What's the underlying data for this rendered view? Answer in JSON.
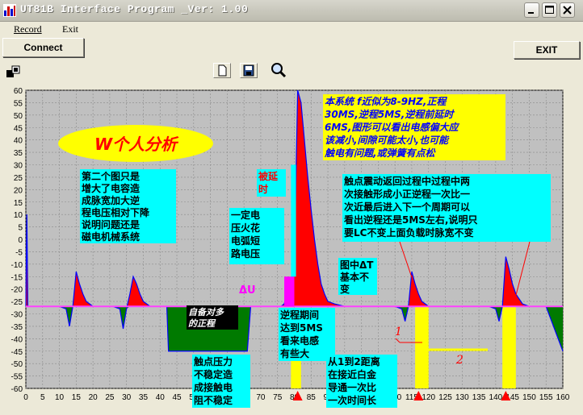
{
  "window": {
    "title": "UT81B Interface Program _Ver: 1.00"
  },
  "menu": {
    "record": "Record",
    "exit": "Exit"
  },
  "toolbar": {
    "connect": "Connect",
    "exit": "EXIT"
  },
  "icons": {
    "app": "bar-chart-icon",
    "minimize": "minimize-icon",
    "maximize": "maximize-icon",
    "close": "close-icon",
    "new": "new-file-icon",
    "save": "save-disk-icon",
    "zoom": "zoom-magnifier-icon",
    "panel": "panel-toggle-icon"
  },
  "colors": {
    "plot_bg": "#c0c0c0",
    "grid": "#8a8a8a",
    "pos_fill": "#ff0000",
    "neg_fill": "#007a00",
    "baseline": "#ff40ff",
    "trace": "#0000ff",
    "highlight": "#ffff00",
    "note_bg": "#ffff00",
    "note_text": "#0000ff",
    "cyan": "#00ffff",
    "magenta": "#ff00ff"
  },
  "chart_data": {
    "type": "area",
    "xlim": [
      0,
      160
    ],
    "ylim": [
      -60,
      60
    ],
    "x_ticks": [
      "0",
      "5",
      "10",
      "15",
      "20",
      "25",
      "30",
      "35",
      "40",
      "45",
      "50",
      "55",
      "60",
      "65",
      "70",
      "75",
      "80",
      "85",
      "90",
      "95",
      "100",
      "105",
      "110",
      "115",
      "120",
      "125",
      "130",
      "135",
      "140",
      "145",
      "150",
      "155",
      "160"
    ],
    "y_ticks": [
      "60",
      "55",
      "50",
      "45",
      "40",
      "35",
      "30",
      "25",
      "20",
      "15",
      "10",
      "5",
      "0",
      "-5",
      "-10",
      "-15",
      "-20",
      "-25",
      "-30",
      "-35",
      "-40",
      "-45",
      "-50",
      "-55",
      "-60"
    ],
    "grid": true,
    "baseline": -27,
    "series": [
      {
        "x": [
          0,
          0.3,
          0.6,
          2,
          5,
          10,
          12,
          13,
          14,
          15,
          16,
          17,
          18,
          19,
          20,
          21,
          22,
          23,
          24,
          26,
          28,
          29,
          30,
          31,
          32,
          33,
          34,
          35,
          36,
          37,
          38,
          39,
          40,
          42,
          42.5,
          43,
          44,
          50,
          60,
          66,
          67,
          68,
          70,
          72,
          75,
          76,
          77,
          78,
          79,
          80,
          81,
          82,
          83,
          84,
          85,
          86,
          87,
          88,
          89,
          90,
          92,
          95,
          98,
          100,
          105,
          110,
          112,
          113,
          114,
          115,
          116,
          117,
          118,
          119,
          120,
          121,
          122,
          125,
          128,
          130,
          132,
          134,
          136,
          138,
          140,
          141,
          142,
          143,
          144,
          145,
          146,
          147,
          148,
          150,
          155,
          160
        ],
        "y": [
          -27,
          10,
          -27,
          -27,
          -27,
          -27,
          -28,
          -35,
          -27,
          -13,
          -18,
          -22,
          -25,
          -26,
          -27,
          -27,
          -27,
          -27,
          -27,
          -27,
          -28,
          -36,
          -28,
          -22,
          -15,
          -18,
          -22,
          -25,
          -26,
          -27,
          -27,
          -27,
          -27,
          -27,
          -45,
          -45,
          -45,
          -45,
          -45,
          -45,
          -27,
          -27,
          -27,
          -27,
          -27,
          -27,
          -26,
          -20,
          -20,
          -10,
          60,
          55,
          40,
          25,
          12,
          0,
          -10,
          -18,
          -22,
          -25,
          -26,
          -27,
          -27,
          -27,
          -27,
          -27,
          -28,
          -33,
          -27,
          -13,
          -18,
          -22,
          -25,
          -26,
          -27,
          -27,
          -27,
          -27,
          -27,
          -27,
          -27,
          -27,
          -27,
          -27,
          -28,
          -33,
          -27,
          -7,
          -12,
          -18,
          -22,
          -24,
          -26,
          -27,
          -27,
          -45
        ]
      }
    ]
  },
  "annotations": {
    "title_note": "W个人分析",
    "note_top_right": [
      "本系统  f近似为8-9HZ,正程",
      "30MS,逆程5MS,逆程前延时",
      "6MS,图形可以看出电感偏大应",
      "该减小,间隙可能太小,也可能",
      "触电有问题,或弹簧有点松"
    ],
    "note_left": [
      "第二个图只是",
      "增大了电容造",
      "成脉宽加大逆",
      "程电压相对下降",
      "说明问题还是",
      "磁电机械系统"
    ],
    "note_delay": [
      "被延",
      "时"
    ],
    "note_spark": [
      "一定电",
      "压火花",
      "电弧短",
      "路电压"
    ],
    "note_delta_u": "ΔU",
    "note_contact": [
      "触点震动返回过程中过程中两",
      "次接触形成小正逆程一次比一",
      "次近最后进入下一个周期可以",
      "看出逆程还是5MS左右,说明只",
      "要LC不变上面负载时脉宽不变"
    ],
    "note_mid": [
      "图中ΔT",
      "基本不",
      "变"
    ],
    "note_black": [
      "自备对多",
      "的正程"
    ],
    "note_pressure": [
      "触点压力",
      "不稳定造",
      "成接触电",
      "阻不稳定"
    ],
    "note_reverse": [
      "逆程期间",
      "达到5MS",
      "看来电感",
      "有些大"
    ],
    "note_distance": [
      "从1到2距离",
      "在接近白金",
      "导通一次比",
      "一次时间长"
    ],
    "marker_1": "1",
    "marker_2": "2"
  }
}
